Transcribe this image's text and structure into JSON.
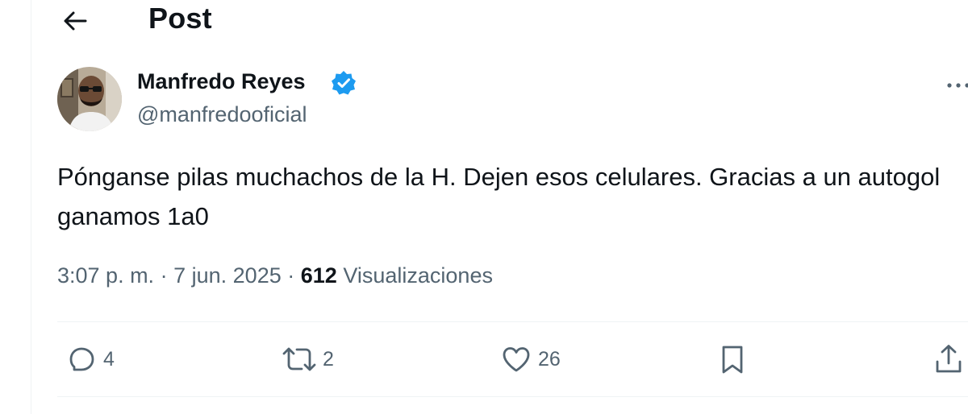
{
  "header": {
    "title": "Post",
    "back_icon": "arrow-left-icon"
  },
  "post": {
    "author": {
      "display_name": "Manfredo Reyes",
      "handle": "@manfredooficial",
      "verified": true,
      "verified_color": "#1d9bf0"
    },
    "text": "Pónganse pilas muchachos de la H. Dejen esos celulares. Gracias a un autogol ganamos 1a0",
    "time": "3:07 p. m.",
    "separator": "·",
    "date": "7 jun. 2025",
    "views_count": "612",
    "views_label": "Visualizaciones",
    "more_icon": "more-horizontal-icon"
  },
  "actions": {
    "replies": {
      "icon": "reply-icon",
      "count": "4"
    },
    "reposts": {
      "icon": "repost-icon",
      "count": "2"
    },
    "likes": {
      "icon": "heart-icon",
      "count": "26"
    },
    "bookmark": {
      "icon": "bookmark-icon"
    },
    "share": {
      "icon": "share-icon"
    }
  },
  "colors": {
    "text_primary": "#0f1419",
    "text_secondary": "#536471",
    "divider": "#eff3f4",
    "accent": "#1d9bf0"
  }
}
